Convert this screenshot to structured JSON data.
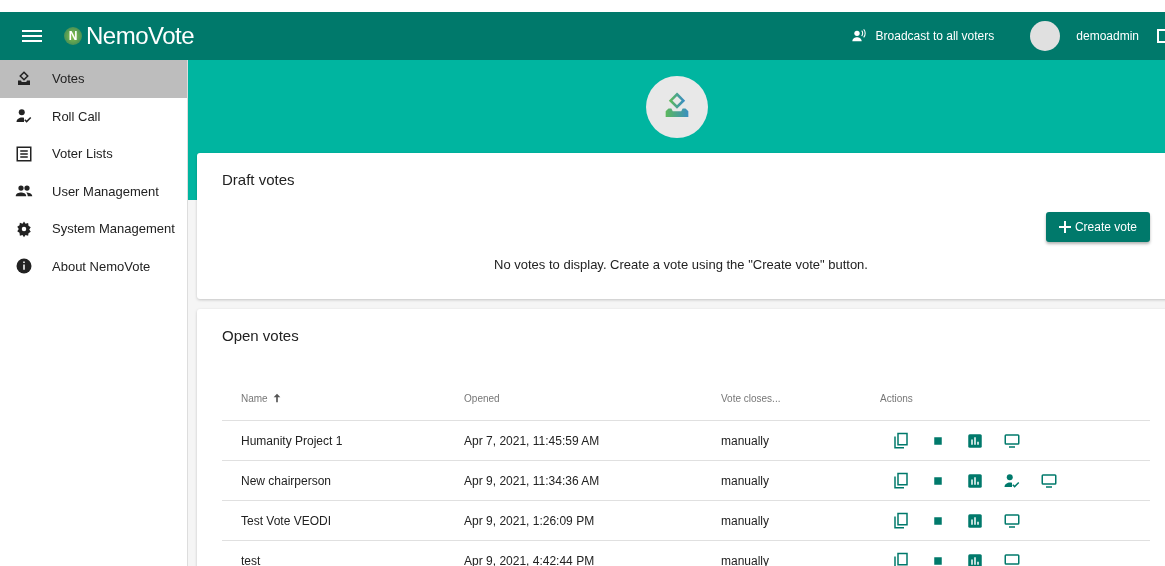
{
  "topbar": {
    "logo_letter": "N",
    "app_name": "NemoVote",
    "broadcast": "Broadcast to all voters",
    "user": "demoadmin"
  },
  "sidebar": {
    "items": [
      {
        "label": "Votes",
        "kind": "ballot",
        "selected": true
      },
      {
        "label": "Roll Call",
        "kind": "rollcall",
        "selected": false
      },
      {
        "label": "Voter Lists",
        "kind": "list",
        "selected": false
      },
      {
        "label": "User Management",
        "kind": "people",
        "selected": false
      },
      {
        "label": "System Management",
        "kind": "gear",
        "selected": false
      },
      {
        "label": "About NemoVote",
        "kind": "info",
        "selected": false
      }
    ]
  },
  "draft": {
    "title": "Draft votes",
    "button": "Create vote",
    "empty": "No votes to display. Create a vote using the \"Create vote\" button."
  },
  "open": {
    "title": "Open votes",
    "columns": [
      "Name",
      "Opened",
      "Vote closes...",
      "Actions"
    ],
    "rows": [
      {
        "name": "Humanity Project 1",
        "opened": "Apr 7, 2021, 11:45:59 AM",
        "closes": "manually",
        "actions": [
          {
            "kind": "copy"
          },
          {
            "kind": "stop"
          },
          {
            "kind": "results"
          },
          {
            "kind": "display"
          }
        ]
      },
      {
        "name": "New chairperson",
        "opened": "Apr 9, 2021, 11:34:36 AM",
        "closes": "manually",
        "actions": [
          {
            "kind": "copy"
          },
          {
            "kind": "stop"
          },
          {
            "kind": "results"
          },
          {
            "kind": "rollcall"
          },
          {
            "kind": "display"
          }
        ]
      },
      {
        "name": "Test Vote VEODI",
        "opened": "Apr 9, 2021, 1:26:09 PM",
        "closes": "manually",
        "actions": [
          {
            "kind": "copy"
          },
          {
            "kind": "stop"
          },
          {
            "kind": "results"
          },
          {
            "kind": "display"
          }
        ]
      },
      {
        "name": "test",
        "opened": "Apr 9, 2021, 4:42:44 PM",
        "closes": "manually",
        "actions": [
          {
            "kind": "copy"
          },
          {
            "kind": "stop"
          },
          {
            "kind": "results"
          },
          {
            "kind": "display"
          }
        ]
      }
    ]
  }
}
